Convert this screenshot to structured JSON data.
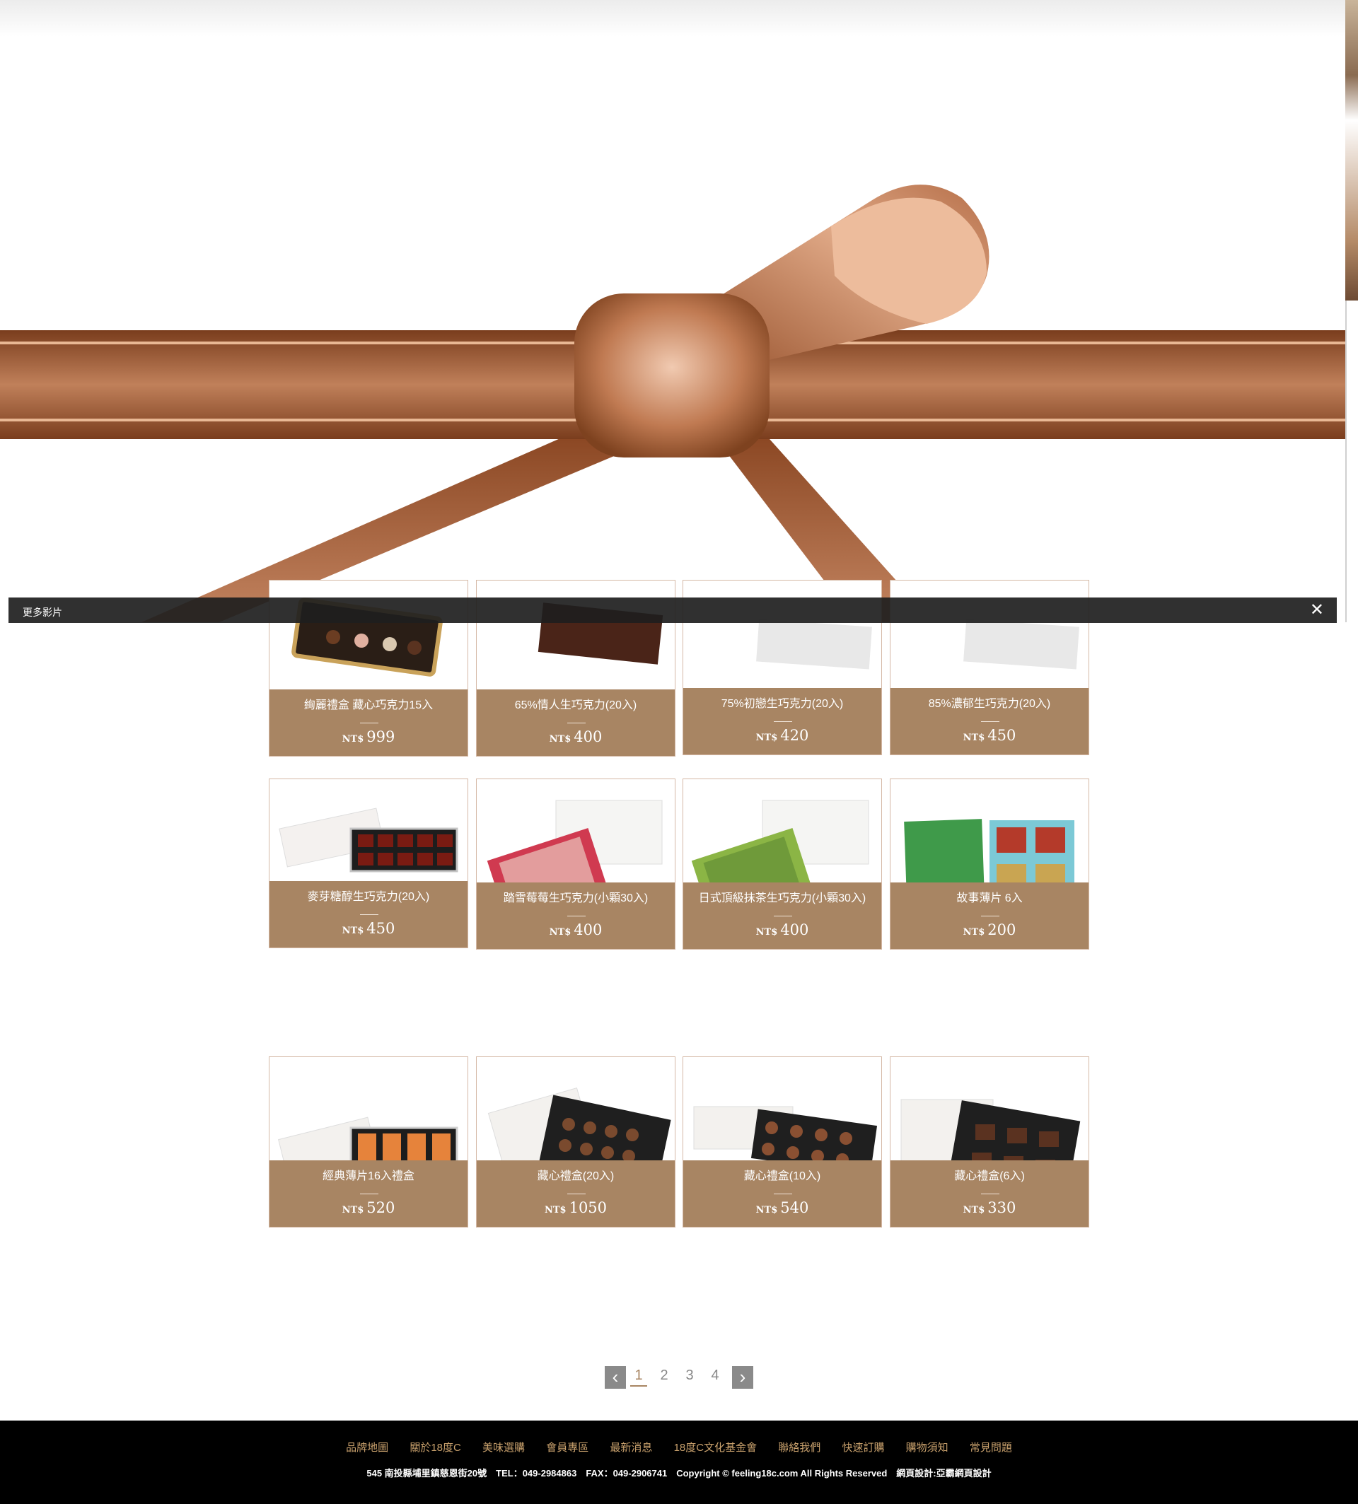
{
  "video_bar": {
    "title": "更多影片",
    "close": "✕"
  },
  "colors": {
    "info_bg": "#a88563",
    "ribbon": "#a65e34",
    "footer_link": "#c9a16d"
  },
  "products": [
    {
      "name": "絢麗禮盒 藏心巧克力15入",
      "currency": "NT$",
      "price": "999"
    },
    {
      "name": "65%情人生巧克力(20入)",
      "currency": "NT$",
      "price": "400"
    },
    {
      "name": "75%初戀生巧克力(20入)",
      "currency": "NT$",
      "price": "420"
    },
    {
      "name": "85%濃郁生巧克力(20入)",
      "currency": "NT$",
      "price": "450"
    },
    {
      "name": "麥芽糖醇生巧克力(20入)",
      "currency": "NT$",
      "price": "450"
    },
    {
      "name": "踏雪莓莓生巧克力(小顆30入)",
      "currency": "NT$",
      "price": "400"
    },
    {
      "name": "日式頂級抹茶生巧克力(小顆30入)",
      "currency": "NT$",
      "price": "400"
    },
    {
      "name": "故事薄片 6入",
      "currency": "NT$",
      "price": "200"
    },
    {
      "name": "經典薄片16入禮盒",
      "currency": "NT$",
      "price": "520"
    },
    {
      "name": "藏心禮盒(20入)",
      "currency": "NT$",
      "price": "1050"
    },
    {
      "name": "藏心禮盒(10入)",
      "currency": "NT$",
      "price": "540"
    },
    {
      "name": "藏心禮盒(6入)",
      "currency": "NT$",
      "price": "330"
    }
  ],
  "pagination": {
    "prev": "‹",
    "next": "›",
    "pages": [
      "1",
      "2",
      "3",
      "4"
    ],
    "current": "1"
  },
  "footer": {
    "nav": [
      "品牌地圖",
      "關於18度C",
      "美味選購",
      "會員專區",
      "最新消息",
      "18度C文化基金會",
      "聯絡我們",
      "快速訂購",
      "購物須知",
      "常見問題"
    ],
    "info": "545 南投縣埔里鎮慈恩街20號　TEL：049-2984863　FAX：049-2906741　Copyright © feeling18c.com All Rights Reserved　網頁設計:亞霸網頁設計"
  }
}
